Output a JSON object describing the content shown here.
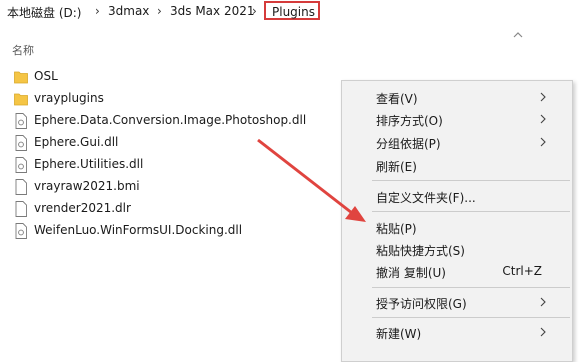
{
  "breadcrumb": {
    "items": [
      "本地磁盘 (D:)",
      "3dmax",
      "3ds Max 2021"
    ],
    "current": "Plugins"
  },
  "column_header": {
    "name": "名称"
  },
  "files": [
    {
      "name": "OSL",
      "icon": "folder-icon"
    },
    {
      "name": "vrayplugins",
      "icon": "folder-icon"
    },
    {
      "name": "Ephere.Data.Conversion.Image.Photoshop.dll",
      "icon": "dll-file-icon"
    },
    {
      "name": "Ephere.Gui.dll",
      "icon": "dll-file-icon"
    },
    {
      "name": "Ephere.Utilities.dll",
      "icon": "dll-file-icon"
    },
    {
      "name": "vrayraw2021.bmi",
      "icon": "file-icon"
    },
    {
      "name": "vrender2021.dlr",
      "icon": "file-icon"
    },
    {
      "name": "WeifenLuo.WinFormsUI.Docking.dll",
      "icon": "dll-file-icon"
    }
  ],
  "context_menu": {
    "items": [
      {
        "label": "查看(V)",
        "submenu": true
      },
      {
        "label": "排序方式(O)",
        "submenu": true
      },
      {
        "label": "分组依据(P)",
        "submenu": true
      },
      {
        "label": "刷新(E)"
      },
      {
        "label": "自定义文件夹(F)..."
      },
      {
        "label": "粘贴(P)"
      },
      {
        "label": "粘贴快捷方式(S)"
      },
      {
        "label": "撤消 复制(U)",
        "shortcut": "Ctrl+Z"
      },
      {
        "label": "授予访问权限(G)",
        "submenu": true
      },
      {
        "label": "新建(W)",
        "submenu": true
      }
    ]
  },
  "colors": {
    "highlight_border": "#d53b3b",
    "annotation_arrow": "#e0443f",
    "folder": "#f5c545"
  }
}
